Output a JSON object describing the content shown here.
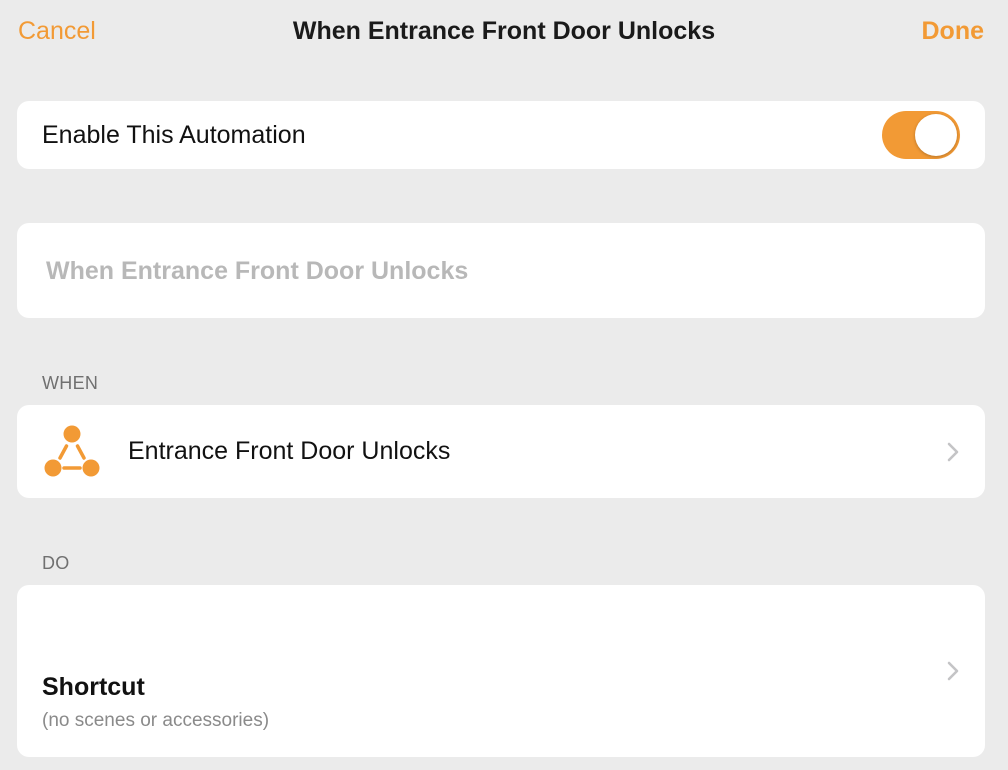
{
  "nav": {
    "cancel_label": "Cancel",
    "title": "When Entrance Front Door Unlocks",
    "done_label": "Done"
  },
  "enable": {
    "label": "Enable This Automation",
    "enabled": true
  },
  "name_field": {
    "placeholder": "When Entrance Front Door Unlocks",
    "value": ""
  },
  "when_section": {
    "header": "WHEN",
    "trigger_label": "Entrance Front Door Unlocks",
    "icon": "accessory-trigger-icon"
  },
  "do_section": {
    "header": "DO",
    "title": "Shortcut",
    "subtitle": "(no scenes or accessories)"
  },
  "colors": {
    "accent": "#f29a35",
    "background": "#ebebeb",
    "card": "#ffffff",
    "placeholder": "#b8b8b8",
    "secondary_text": "#8a8a8a",
    "chevron": "#c4c4c6"
  }
}
